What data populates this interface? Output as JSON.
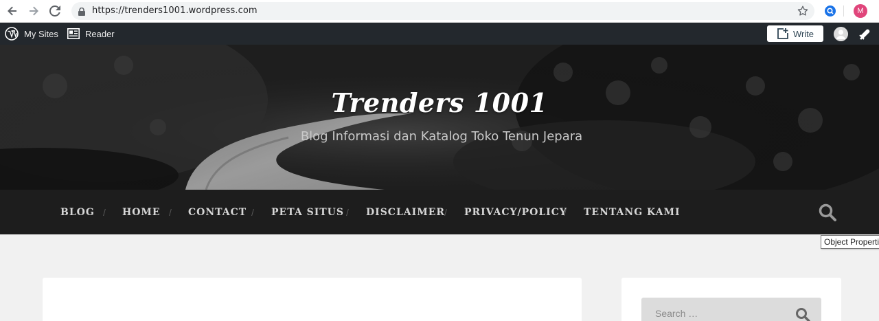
{
  "browser": {
    "url": "https://trenders1001.wordpress.com",
    "profile_initial": "M",
    "icons": [
      "back-arrow-icon",
      "forward-arrow-icon",
      "reload-icon",
      "lock-icon",
      "bookmark-star-icon",
      "extension-icon",
      "profile-avatar"
    ]
  },
  "adminbar": {
    "my_sites": "My Sites",
    "reader": "Reader",
    "write": "Write"
  },
  "header": {
    "title": "Trenders 1001",
    "description": "Blog Informasi dan Katalog Toko Tenun Jepara"
  },
  "menu": {
    "items": [
      "BLOG",
      "HOME",
      "CONTACT",
      "PETA SITUS",
      "DISCLAIMER",
      "PRIVACY/POLICY",
      "TENTANG KAMI"
    ],
    "separator": "/"
  },
  "tooltip": "Object Properties",
  "sidebar": {
    "search_placeholder": "Search …"
  },
  "colors": {
    "adminbar": "#23282d",
    "menubar": "#1d1d1d",
    "page_bg": "#f1f1f1",
    "profile": "#e0457b"
  }
}
